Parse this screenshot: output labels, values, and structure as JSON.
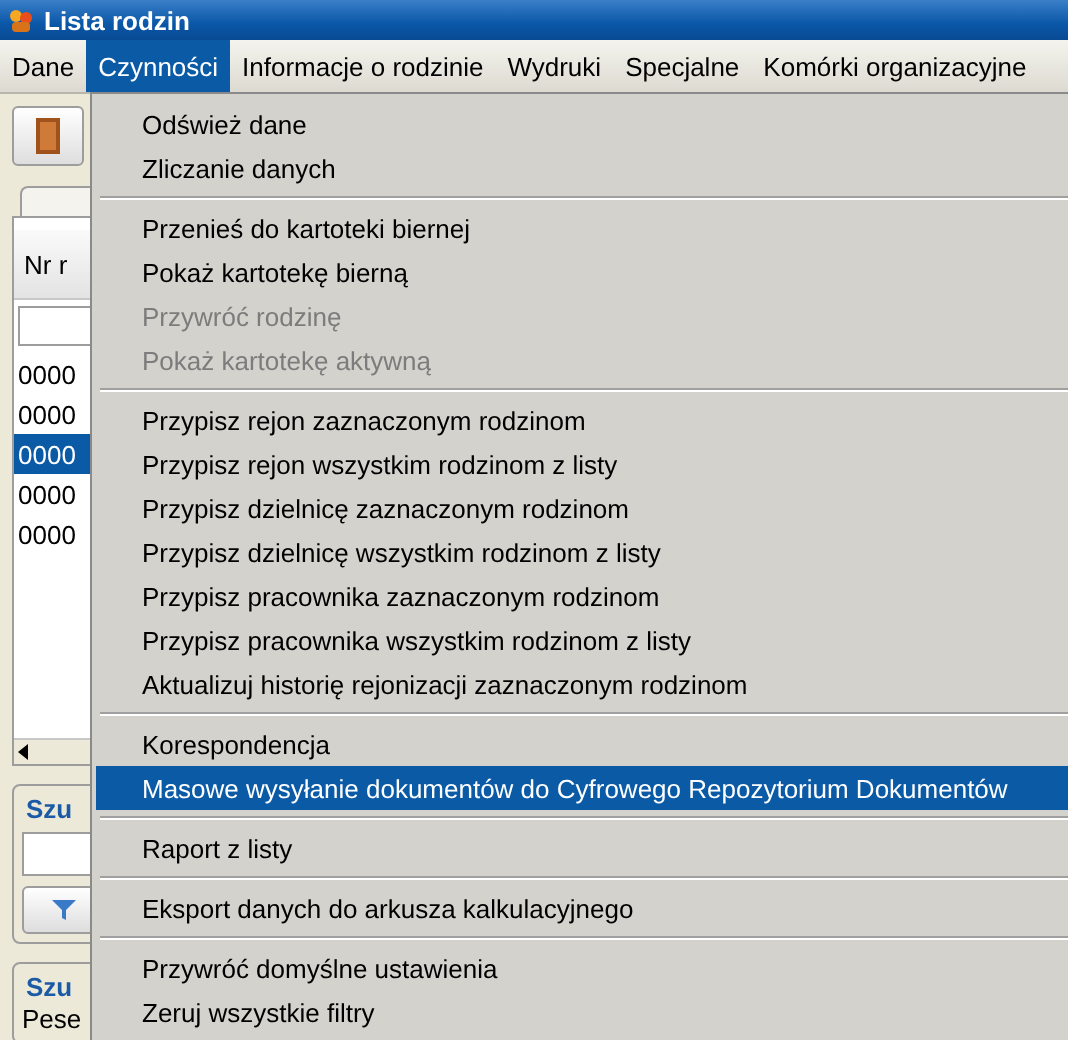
{
  "window": {
    "title": "Lista rodzin"
  },
  "menubar": [
    {
      "label": "Dane",
      "selected": false
    },
    {
      "label": "Czynności",
      "selected": true
    },
    {
      "label": "Informacje o rodzinie",
      "selected": false
    },
    {
      "label": "Wydruki",
      "selected": false
    },
    {
      "label": "Specjalne",
      "selected": false
    },
    {
      "label": "Komórki organizacyjne",
      "selected": false
    }
  ],
  "table": {
    "columns": [
      "Nr r"
    ],
    "rows": [
      {
        "cells": [
          "0000"
        ],
        "selected": false
      },
      {
        "cells": [
          "0000"
        ],
        "selected": false
      },
      {
        "cells": [
          "0000"
        ],
        "selected": true
      },
      {
        "cells": [
          "0000"
        ],
        "selected": false
      },
      {
        "cells": [
          "0000"
        ],
        "selected": false
      }
    ]
  },
  "groups": [
    {
      "title": "Szu"
    },
    {
      "title": "Szu",
      "field_label": "Pese"
    }
  ],
  "menu": {
    "items": [
      {
        "kind": "item",
        "label": "Odśwież dane",
        "disabled": false,
        "selected": false
      },
      {
        "kind": "item",
        "label": "Zliczanie danych",
        "disabled": false,
        "selected": false
      },
      {
        "kind": "separator"
      },
      {
        "kind": "item",
        "label": "Przenieś do kartoteki biernej",
        "disabled": false,
        "selected": false
      },
      {
        "kind": "item",
        "label": "Pokaż kartotekę bierną",
        "disabled": false,
        "selected": false
      },
      {
        "kind": "item",
        "label": "Przywróć rodzinę",
        "disabled": true,
        "selected": false
      },
      {
        "kind": "item",
        "label": "Pokaż kartotekę aktywną",
        "disabled": true,
        "selected": false
      },
      {
        "kind": "separator"
      },
      {
        "kind": "item",
        "label": "Przypisz rejon zaznaczonym rodzinom",
        "disabled": false,
        "selected": false
      },
      {
        "kind": "item",
        "label": "Przypisz rejon wszystkim rodzinom z listy",
        "disabled": false,
        "selected": false
      },
      {
        "kind": "item",
        "label": "Przypisz dzielnicę zaznaczonym rodzinom",
        "disabled": false,
        "selected": false
      },
      {
        "kind": "item",
        "label": "Przypisz dzielnicę wszystkim rodzinom z listy",
        "disabled": false,
        "selected": false
      },
      {
        "kind": "item",
        "label": "Przypisz pracownika zaznaczonym rodzinom",
        "disabled": false,
        "selected": false
      },
      {
        "kind": "item",
        "label": "Przypisz pracownika wszystkim rodzinom z listy",
        "disabled": false,
        "selected": false
      },
      {
        "kind": "item",
        "label": "Aktualizuj historię rejonizacji zaznaczonym rodzinom",
        "disabled": false,
        "selected": false
      },
      {
        "kind": "separator"
      },
      {
        "kind": "item",
        "label": "Korespondencja",
        "disabled": false,
        "selected": false
      },
      {
        "kind": "item",
        "label": "Masowe wysyłanie dokumentów do Cyfrowego Repozytorium Dokumentów",
        "disabled": false,
        "selected": true
      },
      {
        "kind": "separator"
      },
      {
        "kind": "item",
        "label": "Raport z listy",
        "disabled": false,
        "selected": false
      },
      {
        "kind": "separator"
      },
      {
        "kind": "item",
        "label": "Eksport danych do arkusza kalkulacyjnego",
        "disabled": false,
        "selected": false
      },
      {
        "kind": "separator"
      },
      {
        "kind": "item",
        "label": "Przywróć domyślne ustawienia",
        "disabled": false,
        "selected": false
      },
      {
        "kind": "item",
        "label": "Zeruj wszystkie filtry",
        "disabled": false,
        "selected": false
      }
    ]
  }
}
